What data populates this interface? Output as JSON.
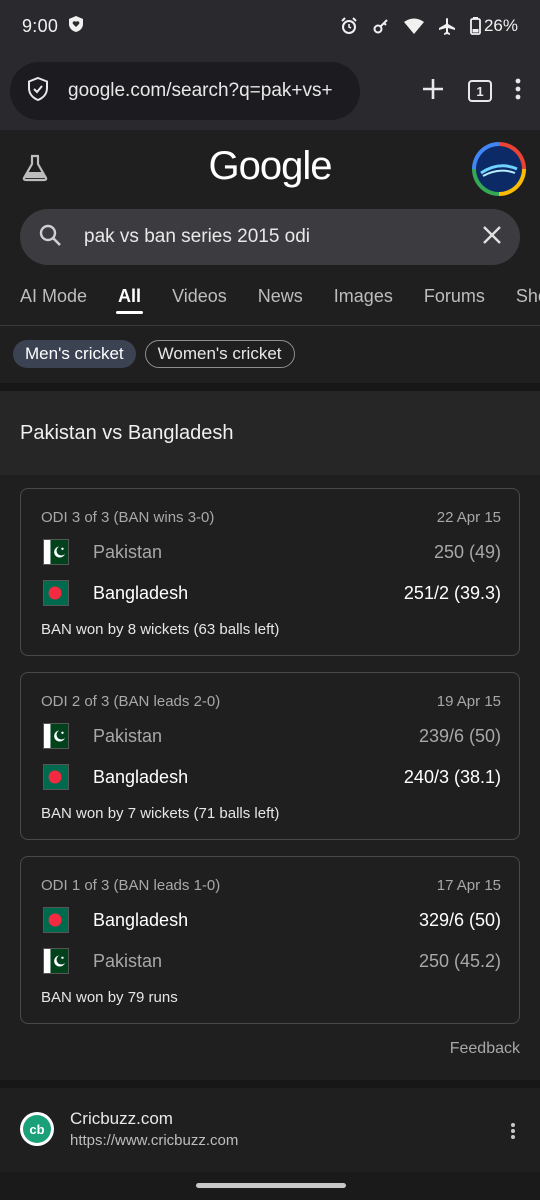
{
  "status_bar": {
    "time": "9:00",
    "battery": "26%"
  },
  "browser": {
    "url": "google.com/search?q=pak+vs+",
    "tab_count": "1"
  },
  "google": {
    "logo": "Google"
  },
  "search": {
    "query": "pak vs ban series 2015 odi"
  },
  "tabs": [
    {
      "label": "AI Mode"
    },
    {
      "label": "All",
      "active": true
    },
    {
      "label": "Videos"
    },
    {
      "label": "News"
    },
    {
      "label": "Images"
    },
    {
      "label": "Forums"
    },
    {
      "label": "Shor"
    }
  ],
  "chips": [
    {
      "label": "Men's cricket",
      "selected": true
    },
    {
      "label": "Women's cricket",
      "selected": false
    }
  ],
  "card": {
    "title": "Pakistan vs Bangladesh"
  },
  "matches": [
    {
      "label": "ODI 3 of 3 (BAN wins 3-0)",
      "date": "22 Apr 15",
      "teams": [
        {
          "name": "Pakistan",
          "score": "250 (49)",
          "flag": "pakistan-flag",
          "winner": false
        },
        {
          "name": "Bangladesh",
          "score": "251/2 (39.3)",
          "flag": "bangladesh-flag",
          "winner": true
        }
      ],
      "result": "BAN won by 8 wickets (63 balls left)"
    },
    {
      "label": "ODI 2 of 3 (BAN leads 2-0)",
      "date": "19 Apr 15",
      "teams": [
        {
          "name": "Pakistan",
          "score": "239/6 (50)",
          "flag": "pakistan-flag",
          "winner": false
        },
        {
          "name": "Bangladesh",
          "score": "240/3 (38.1)",
          "flag": "bangladesh-flag",
          "winner": true
        }
      ],
      "result": "BAN won by 7 wickets (71 balls left)"
    },
    {
      "label": "ODI 1 of 3 (BAN leads 1-0)",
      "date": "17 Apr 15",
      "teams": [
        {
          "name": "Bangladesh",
          "score": "329/6 (50)",
          "flag": "bangladesh-flag",
          "winner": true
        },
        {
          "name": "Pakistan",
          "score": "250 (45.2)",
          "flag": "pakistan-flag",
          "winner": false
        }
      ],
      "result": "BAN won by 79 runs"
    }
  ],
  "feedback": "Feedback",
  "result_item": {
    "site": "Cricbuzz.com",
    "url": "https://www.cricbuzz.com",
    "logo_text": "cb"
  },
  "colors": {
    "background": "#1f1f1f",
    "pakistan_green": "#01411c",
    "bangladesh_green": "#006a4e",
    "bangladesh_red": "#f42a41",
    "cricbuzz_green": "#1aa179"
  }
}
